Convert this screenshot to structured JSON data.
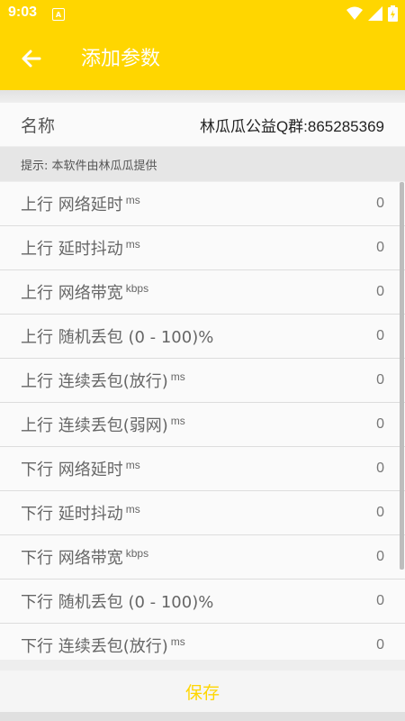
{
  "status": {
    "time": "9:03",
    "app_badge": "A"
  },
  "toolbar": {
    "title": "添加参数"
  },
  "name_row": {
    "label": "名称",
    "value": "林瓜瓜公益Q群:865285369"
  },
  "hint": "提示: 本软件由林瓜瓜提供",
  "params": [
    {
      "label": "上行 网络延时",
      "unit": "ms",
      "value": "0"
    },
    {
      "label": "上行 延时抖动",
      "unit": "ms",
      "value": "0"
    },
    {
      "label": "上行 网络带宽",
      "unit": "kbps",
      "value": "0"
    },
    {
      "label": "上行 随机丢包 (0 - 100)%",
      "unit": "",
      "value": "0"
    },
    {
      "label": "上行 连续丢包(放行)",
      "unit": "ms",
      "value": "0"
    },
    {
      "label": "上行 连续丢包(弱网)",
      "unit": "ms",
      "value": "0"
    },
    {
      "label": "下行 网络延时",
      "unit": "ms",
      "value": "0"
    },
    {
      "label": "下行 延时抖动",
      "unit": "ms",
      "value": "0"
    },
    {
      "label": "下行 网络带宽",
      "unit": "kbps",
      "value": "0"
    },
    {
      "label": "下行 随机丢包 (0 - 100)%",
      "unit": "",
      "value": "0"
    },
    {
      "label": "下行 连续丢包(放行)",
      "unit": "ms",
      "value": "0"
    }
  ],
  "save_label": "保存",
  "colors": {
    "accent": "#ffd600",
    "background": "#eeeeee"
  }
}
